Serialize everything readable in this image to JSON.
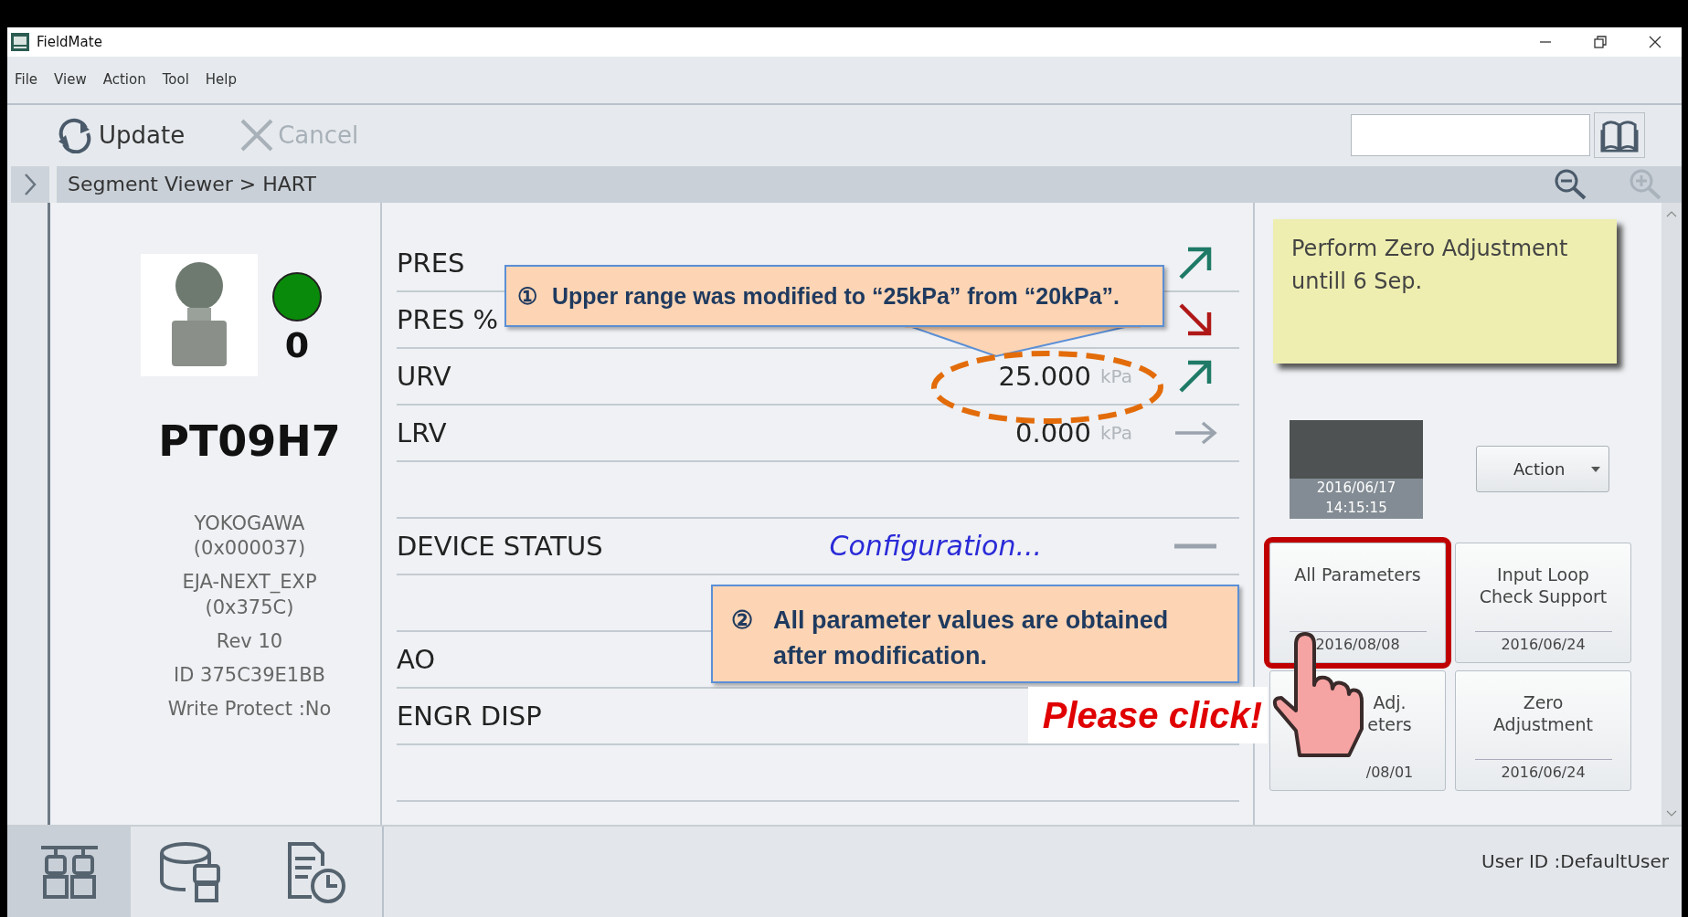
{
  "window": {
    "title": "FieldMate"
  },
  "menu": [
    "File",
    "View",
    "Action",
    "Tool",
    "Help"
  ],
  "toolbar": [
    {
      "label": "Update",
      "kind": "update",
      "disabled": false
    },
    {
      "label": "Cancel",
      "kind": "cancel",
      "disabled": true
    }
  ],
  "breadcrumb": "Segment Viewer > HART",
  "device": {
    "color": "#0a8a0a",
    "count": "0",
    "tag": "PT09H7",
    "info": [
      "YOKOGAWA\n(0x000037)",
      "EJA-NEXT_EXP\n(0x375C)",
      "Rev 10",
      "ID 375C39E1BB",
      "Write Protect :No"
    ]
  },
  "parameters": [
    {
      "kind": "value",
      "label": "PRES",
      "trend": {
        "kind": "up"
      }
    },
    {
      "kind": "value",
      "label": "PRES %",
      "trend": {
        "kind": "down"
      }
    },
    {
      "kind": "value",
      "label": "URV",
      "value": "25.000",
      "unit": "kPa",
      "trend": {
        "kind": "up"
      }
    },
    {
      "kind": "value",
      "label": "LRV",
      "value": "0.000",
      "unit": "kPa",
      "trend": {
        "kind": "flat"
      }
    },
    {
      "kind": "blank"
    },
    {
      "kind": "status",
      "label": "DEVICE STATUS",
      "status": "Configuration...",
      "trend": {
        "kind": "dash"
      }
    },
    {
      "kind": "blank"
    },
    {
      "kind": "value",
      "label": "AO"
    },
    {
      "kind": "value",
      "label": "ENGR DISP"
    },
    {
      "kind": "blank"
    }
  ],
  "annotations": [
    {
      "number": "①",
      "text": "Upper range was modified to “25kPa” from “20kPa”."
    },
    {
      "number": "②",
      "text": "All parameter values are obtained after modification."
    }
  ],
  "click_hint": "Please click!",
  "note": "Perform Zero Adjustment untill 6 Sep.",
  "photo": {
    "date": "2016/06/17",
    "time": "14:15:15"
  },
  "action_button": "Action",
  "tiles": [
    {
      "lines": [
        "All Parameters"
      ],
      "date": "2016/08/08",
      "highlighted": true
    },
    {
      "lines": [
        "Input Loop",
        "Check Support"
      ],
      "date": "2016/06/24",
      "highlighted": false
    },
    {
      "lines": [
        "Adj.",
        "eters"
      ],
      "date": "/08/01",
      "highlighted": false
    },
    {
      "lines": [
        "Zero",
        "Adjustment"
      ],
      "date": "2016/06/24",
      "highlighted": false
    }
  ],
  "bottom_tabs": [
    {
      "kind": "devices",
      "selected": true
    },
    {
      "kind": "database",
      "selected": false
    },
    {
      "kind": "history",
      "selected": false
    }
  ],
  "status_bar": "User ID :DefaultUser"
}
